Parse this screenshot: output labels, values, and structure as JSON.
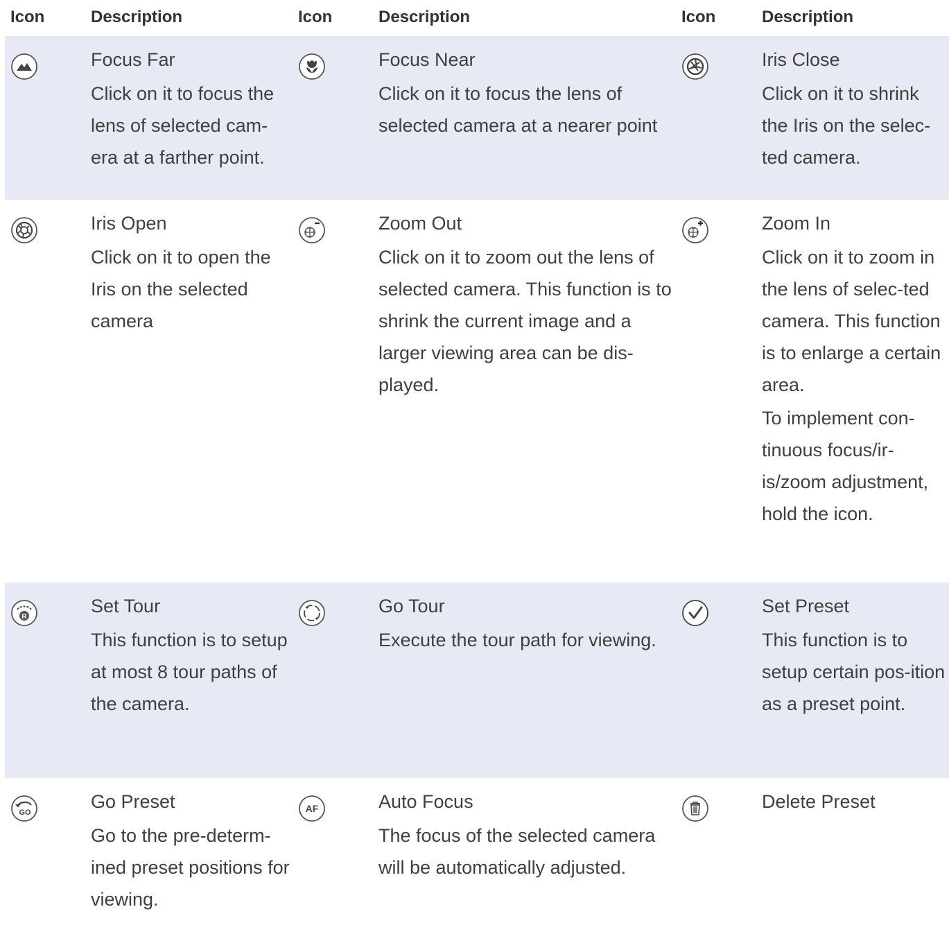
{
  "headers": [
    "Icon",
    "Description",
    "Icon",
    "Description",
    "Icon",
    "Description"
  ],
  "rows": [
    {
      "cells": [
        {
          "icon": "focus-far-icon",
          "name": "Focus Far",
          "lines": [
            "Click on it to focus the lens of selected cam-era at a farther point."
          ]
        },
        {
          "icon": "focus-near-icon",
          "name": "Focus Near",
          "lines": [
            "Click on it to focus the lens of selected camera at a nearer point"
          ]
        },
        {
          "icon": "iris-close-icon",
          "name": "Iris Close",
          "lines": [
            "Click on it to shrink the Iris on the selec-ted camera."
          ]
        }
      ]
    },
    {
      "cells": [
        {
          "icon": "iris-open-icon",
          "name": "Iris Open",
          "lines": [
            "Click on it to open the Iris on the selected camera"
          ]
        },
        {
          "icon": "zoom-out-icon",
          "name": "Zoom Out",
          "lines": [
            "Click on it to zoom out the lens of selected camera. This function is to shrink the current image and a larger viewing area can be dis-played."
          ]
        },
        {
          "icon": "zoom-in-icon",
          "name": "Zoom In",
          "lines": [
            "Click on it to zoom in the lens of selec-ted camera. This function is to enlarge a certain area.",
            "To implement con-tinuous focus/ir-is/zoom adjustment, hold the icon."
          ]
        }
      ]
    },
    {
      "cells": [
        {
          "icon": "set-tour-icon",
          "name": "Set Tour",
          "lines": [
            "This function is to setup at most 8 tour paths of the camera."
          ]
        },
        {
          "icon": "go-tour-icon",
          "name": "Go Tour",
          "lines": [
            "Execute the tour path for viewing."
          ]
        },
        {
          "icon": "set-preset-icon",
          "name": "Set Preset",
          "lines": [
            "This function is to setup certain pos-ition as a preset point."
          ]
        }
      ]
    },
    {
      "cells": [
        {
          "icon": "go-preset-icon",
          "name": "Go Preset",
          "lines": [
            "Go to the pre-determ-ined preset positions for viewing."
          ]
        },
        {
          "icon": "auto-focus-icon",
          "name": "Auto Focus",
          "lines": [
            "The focus of the selected camera will be automatically adjusted."
          ]
        },
        {
          "icon": "delete-preset-icon",
          "name": "Delete Preset",
          "lines": []
        }
      ]
    }
  ],
  "icon_glyphs": {
    "set_tour_badge": "R",
    "go_preset_badge": "GO",
    "auto_focus_badge": "AF"
  },
  "colors": {
    "shaded_row": "#e7e9f4",
    "text": "#3f3f3f",
    "header_text": "#333333",
    "icon_stroke": "#555555"
  }
}
